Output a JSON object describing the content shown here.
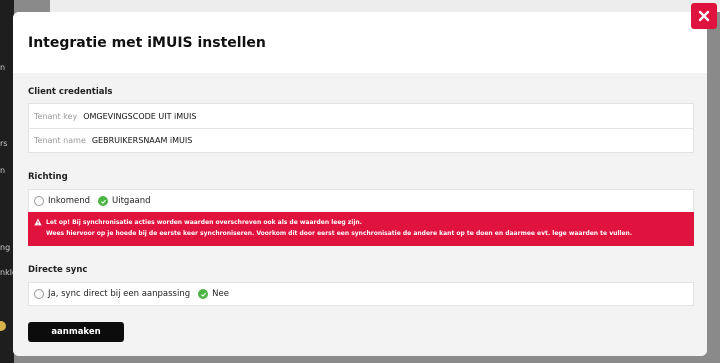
{
  "sidebar": {
    "fragments": [
      "n",
      "rs",
      "n",
      "ng",
      "nklc"
    ]
  },
  "modal": {
    "title": "Integratie met iMUIS instellen",
    "credentials": {
      "heading": "Client credentials",
      "tenant_key_label": "Tenant key",
      "tenant_key_value": "OMGEVINGSCODE UIT iMUIS",
      "tenant_name_label": "Tenant name",
      "tenant_name_value": "GEBRUIKERSNAAM iMUIS"
    },
    "richting": {
      "heading": "Richting",
      "option_in": "Inkomend",
      "option_out": "Uitgaand",
      "selected": "Uitgaand"
    },
    "warning": {
      "line1": "Let op! Bij synchronisatie acties worden waarden overschreven ook als de waarden leeg zijn.",
      "line2": "Wees hiervoor op je hoede bij de eerste keer synchroniseren. Voorkom dit door eerst een synchronisatie de andere kant op te doen en daarmee evt. lege waarden te vullen."
    },
    "directe_sync": {
      "heading": "Directe sync",
      "option_yes": "Ja, sync direct bij een aanpassing",
      "option_no": "Nee",
      "selected": "Nee"
    },
    "submit_label": "aanmaken"
  },
  "colors": {
    "accent": "#e0123e",
    "success": "#4bb543",
    "button": "#0c0c0c"
  }
}
